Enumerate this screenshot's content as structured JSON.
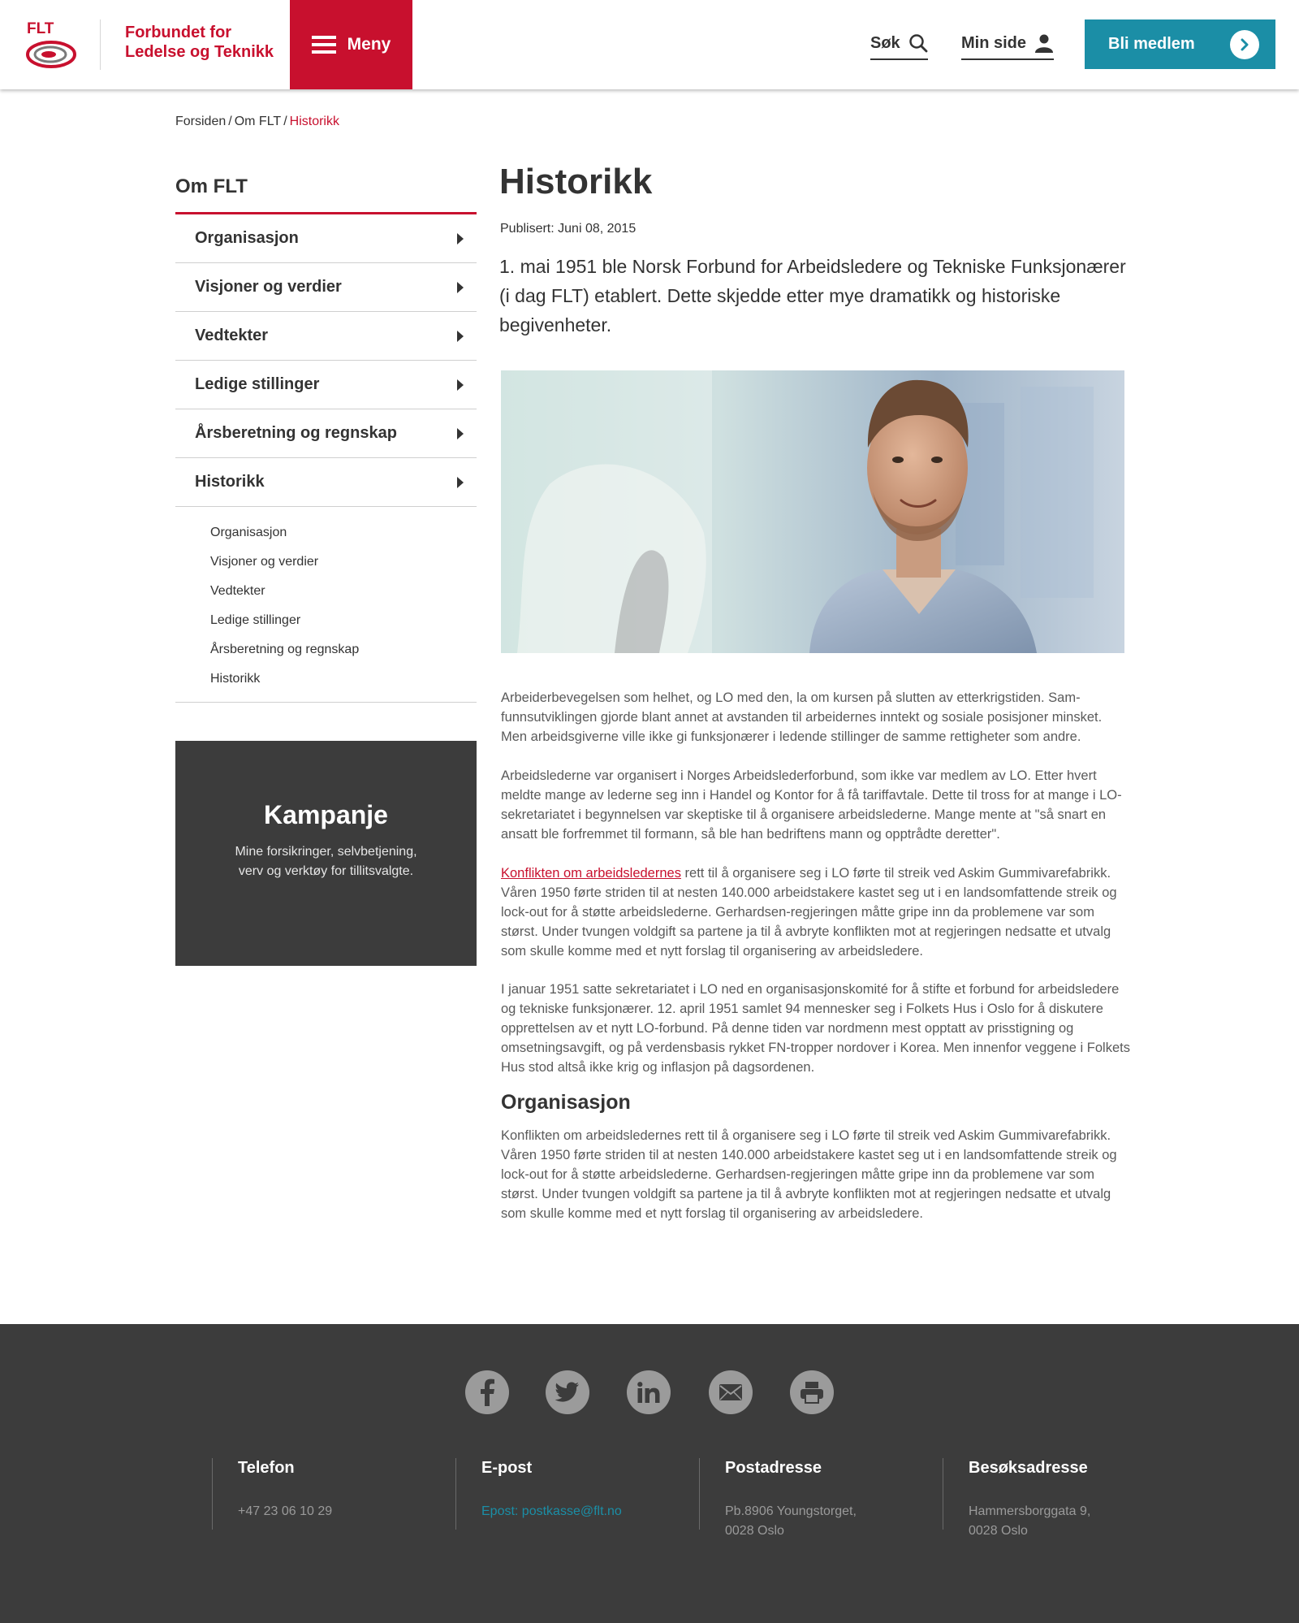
{
  "header": {
    "logo_text": "FLT",
    "brand_line1": "Forbundet for",
    "brand_line2": "Ledelse og Teknikk",
    "menu_label": "Meny",
    "search_label": "Søk",
    "mypage_label": "Min side",
    "join_label": "Bli medlem",
    "accent_red": "#c8102e",
    "accent_teal": "#1b8ea6"
  },
  "breadcrumb": {
    "items": [
      "Forsiden",
      "Om FLT"
    ],
    "separator": "/",
    "current": "Historikk"
  },
  "sidebar": {
    "title": "Om FLT",
    "items": [
      {
        "label": "Organisasjon"
      },
      {
        "label": "Visjoner og verdier"
      },
      {
        "label": "Vedtekter"
      },
      {
        "label": "Ledige stillinger"
      },
      {
        "label": "Årsberetning og regnskap"
      },
      {
        "label": "Historikk"
      }
    ],
    "sub_items": [
      {
        "label": "Organisasjon"
      },
      {
        "label": "Visjoner og verdier"
      },
      {
        "label": "Vedtekter"
      },
      {
        "label": "Ledige stillinger"
      },
      {
        "label": "Årsberetning og regnskap"
      },
      {
        "label": "Historikk"
      }
    ]
  },
  "campaign": {
    "title": "Kampanje",
    "text": "Mine forsikringer, selvbetjening, verv og verktøy for tillitsvalgte."
  },
  "article": {
    "title": "Historikk",
    "published": "Publisert: Juni 08, 2015",
    "lead": "1. mai 1951 ble Norsk Forbund for Arbeidsledere og Tekniske Funks­jonærer (i dag FLT) etablert. Dette skjedde etter mye dramatikk og his­toriske begivenheter.",
    "p1": "Arbeiderbevegelsen som helhet, og LO med den, la om kursen på slutten av etterkrigstiden. Sam­funnsutviklingen gjorde blant annet at avstanden til arbeidernes inntekt og sosiale posisjoner minsket. Men arbeidsgiverne ville ikke gi funksjonærer i ledende stillinger de samme rettigheter som andre.",
    "p2": "Arbeidslederne var organisert i Norges Arbeidslederforbund, som ikke var medlem av LO. Etter hvert meldte mange av lederne seg inn i Handel og Kontor for å få tariffavtale. Dette til tross for at mange i LO-sekretariatet i begynnelsen var skeptiske til å organisere arbeidslederne. Mange mente at \"så snart en ansatt ble forfremmet til formann, så ble han bedriftens mann og opptrådte deretter\".",
    "p3_link": "Konflikten om arbeidsledernes",
    "p3_rest": " rett til å organisere seg i LO førte til streik ved Askim Gummivarefabrikk. Våren 1950 førte striden til at nesten 140.000 arbeidstakere kastet seg ut i en landsomfattende streik og lock-out for å støtte arbeidslederne. Gerhardsen-regjeringen måtte gripe inn da problemene var som størst. Under tvungen voldgift sa partene ja til å avbryte konflikten mot at regjeringen nedsatte et utvalg som skulle komme med et nytt forslag til organisering av arbeidsledere.",
    "p4": "I januar 1951 satte sekretariatet i LO ned en organisasjonskomité for å stifte et forbund for arbeid­sledere og tekniske funksjonærer. 12. april 1951 samlet 94 mennesker seg i Folkets Hus i Oslo for å diskutere opprettelsen av et nytt LO-forbund. På denne tiden var nordmenn mest opptatt av prisstigning og omsetningsavgift, og på verdensbasis rykket FN-tropper nordover i Korea. Men innenfor veggene i Folkets Hus stod altså ikke krig og inflasjon på dagsordenen.",
    "subheading": "Organisasjon",
    "p5": "Konflikten om arbeidsledernes rett til å organisere seg i LO førte til streik ved Askim Gummivarefabrikk. Våren 1950 førte striden til at nesten 140.000 arbeidstakere kastet seg ut i en landsomfattende streik og lock-out for å støtte arbeidslederne. Gerhardsen-regjeringen måtte gripe inn da problemene var som størst. Under tvungen voldgift sa partene ja til å avbryte konflikten mot at regjeringen nedsatte et utvalg som skulle komme med et nytt forslag til organisering av arbeidsledere."
  },
  "footer": {
    "social_icons": [
      "facebook-icon",
      "twitter-icon",
      "linkedin-icon",
      "email-icon",
      "print-icon"
    ],
    "columns": [
      {
        "heading": "Telefon",
        "value": "+47 23 06 10 29"
      },
      {
        "heading": "E-post",
        "value": "Epost: postkasse@flt.no"
      },
      {
        "heading": "Postadresse",
        "value": "Pb.8906 Youngstorget,\n0028 Oslo"
      },
      {
        "heading": "Besøksadresse",
        "value": "Hammersborggata 9,\n0028 Oslo"
      }
    ]
  }
}
